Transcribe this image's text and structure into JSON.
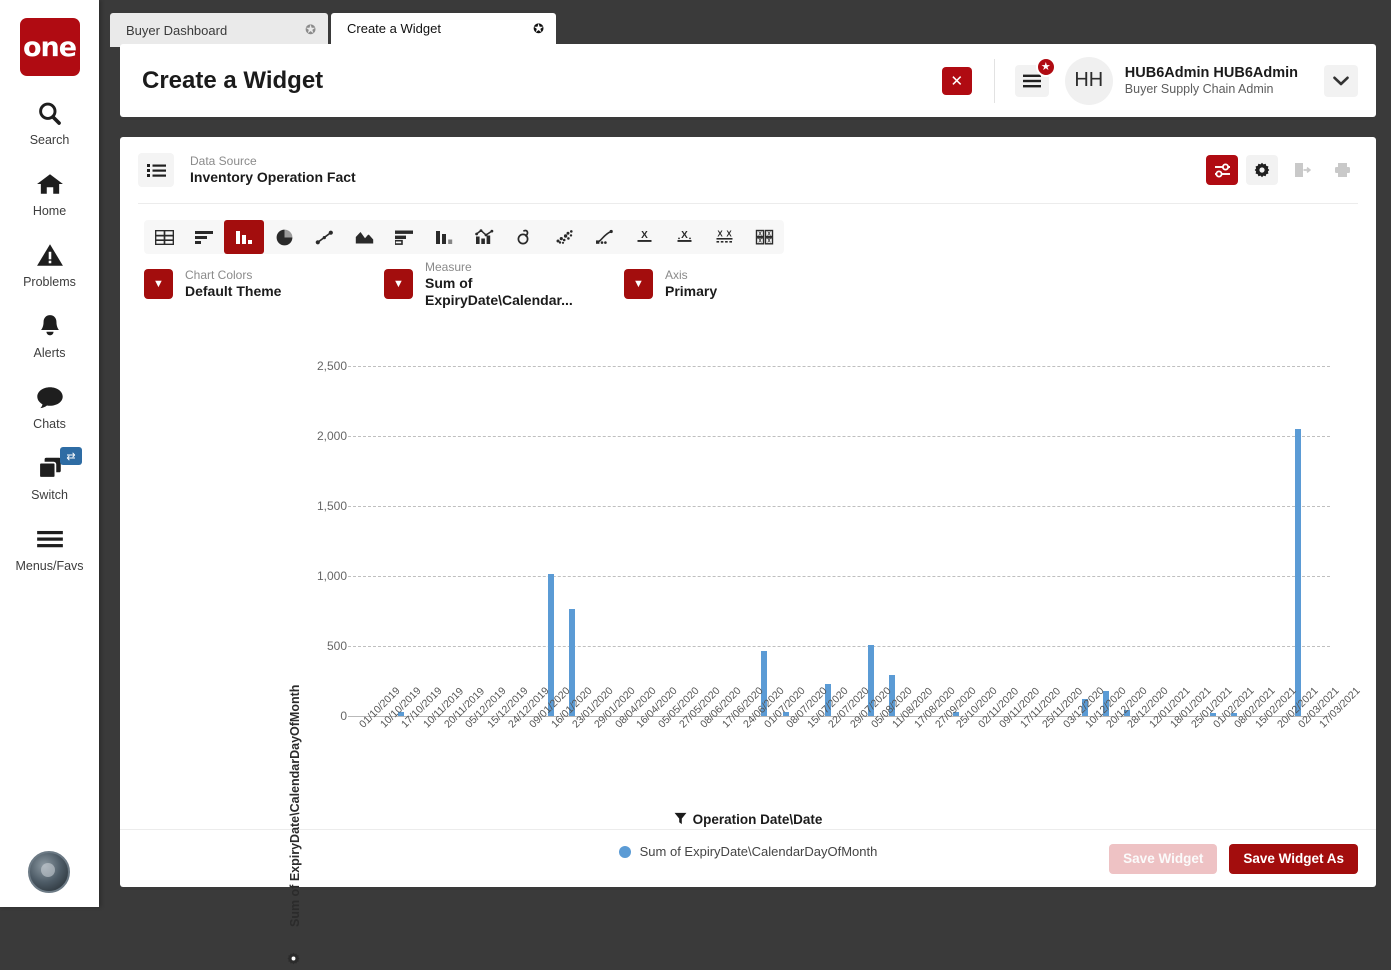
{
  "rail": {
    "logo_text": "one",
    "items": [
      {
        "label": "Search",
        "icon": "search-icon"
      },
      {
        "label": "Home",
        "icon": "home-icon"
      },
      {
        "label": "Problems",
        "icon": "warning-triangle-icon"
      },
      {
        "label": "Alerts",
        "icon": "bell-icon"
      },
      {
        "label": "Chats",
        "icon": "chat-bubble-icon"
      },
      {
        "label": "Switch",
        "icon": "windows-stack-icon",
        "badge": "⇄"
      },
      {
        "label": "Menus/Favs",
        "icon": "hamburger-icon"
      }
    ]
  },
  "tabs": [
    {
      "label": "Buyer Dashboard",
      "active": false
    },
    {
      "label": "Create a Widget",
      "active": true
    }
  ],
  "header": {
    "title": "Create a Widget",
    "close_label": "✕",
    "menu_badge": "★",
    "avatar_initials": "HH",
    "user_name": "HUB6Admin HUB6Admin",
    "user_role": "Buyer Supply Chain Admin",
    "caret": "⌄"
  },
  "source": {
    "label": "Data Source",
    "value": "Inventory Operation Fact",
    "actions": [
      {
        "name": "settings-sliders-icon",
        "state": "active"
      },
      {
        "name": "gear-icon",
        "state": "normal"
      },
      {
        "name": "export-icon",
        "state": "disabled"
      },
      {
        "name": "print-icon",
        "state": "disabled"
      }
    ]
  },
  "chart_types": [
    {
      "name": "table-icon",
      "active": false
    },
    {
      "name": "horizontal-bar-icon",
      "active": false
    },
    {
      "name": "column-bar-icon",
      "active": true
    },
    {
      "name": "pie-chart-icon",
      "active": false
    },
    {
      "name": "line-chart-icon",
      "active": false
    },
    {
      "name": "area-chart-icon",
      "active": false
    },
    {
      "name": "stacked-bar-icon",
      "active": false
    },
    {
      "name": "grouped-column-icon",
      "active": false
    },
    {
      "name": "combo-chart-icon",
      "active": false
    },
    {
      "name": "gauge-icon",
      "active": false
    },
    {
      "name": "bubble-chart-icon",
      "active": false
    },
    {
      "name": "scatter-line-icon",
      "active": false
    },
    {
      "name": "single-kpi-icon",
      "active": false
    },
    {
      "name": "kpi-trend-icon",
      "active": false
    },
    {
      "name": "multi-kpi-icon",
      "active": false
    },
    {
      "name": "kpi-grid-icon",
      "active": false
    }
  ],
  "selectors": [
    {
      "label": "Chart Colors",
      "value": "Default Theme"
    },
    {
      "label": "Measure",
      "value": "Sum of ExpiryDate\\Calendar..."
    },
    {
      "label": "Axis",
      "value": "Primary"
    }
  ],
  "chart_data": {
    "type": "bar",
    "title": "",
    "xlabel": "Operation Date\\Date",
    "ylabel": "Sum of ExpiryDate\\CalendarDayOfMonth",
    "ylim": [
      0,
      2500
    ],
    "yticks": [
      "0",
      "500",
      "1,000",
      "1,500",
      "2,000",
      "2,500"
    ],
    "ytick_values": [
      0,
      500,
      1000,
      1500,
      2000,
      2500
    ],
    "grid": true,
    "legend_position": "bottom",
    "series": [
      {
        "name": "Sum of ExpiryDate\\CalendarDayOfMonth",
        "color": "#5b9bd5"
      }
    ],
    "categories": [
      "01/10/2019",
      "10/10/2019",
      "17/10/2019",
      "10/11/2019",
      "20/11/2019",
      "05/12/2019",
      "15/12/2019",
      "24/12/2019",
      "09/01/2020",
      "16/01/2020",
      "23/01/2020",
      "29/01/2020",
      "08/04/2020",
      "16/04/2020",
      "05/05/2020",
      "27/05/2020",
      "08/06/2020",
      "17/06/2020",
      "24/06/2020",
      "01/07/2020",
      "08/07/2020",
      "15/07/2020",
      "22/07/2020",
      "29/07/2020",
      "05/08/2020",
      "11/08/2020",
      "17/08/2020",
      "27/09/2020",
      "25/10/2020",
      "02/11/2020",
      "09/11/2020",
      "17/11/2020",
      "25/11/2020",
      "03/12/2020",
      "10/12/2020",
      "20/12/2020",
      "28/12/2020",
      "12/01/2021",
      "18/01/2021",
      "25/01/2021",
      "01/02/2021",
      "08/02/2021",
      "15/02/2021",
      "20/02/2021",
      "02/03/2021",
      "17/03/2021"
    ],
    "values": [
      0,
      0,
      30,
      0,
      0,
      0,
      0,
      0,
      0,
      1015,
      765,
      0,
      0,
      0,
      0,
      0,
      0,
      0,
      0,
      465,
      30,
      0,
      230,
      0,
      505,
      290,
      0,
      0,
      30,
      0,
      0,
      0,
      0,
      0,
      120,
      180,
      40,
      0,
      0,
      0,
      25,
      20,
      0,
      0,
      2050,
      0
    ]
  },
  "footer": {
    "save_widget": "Save Widget",
    "save_widget_as": "Save Widget As"
  }
}
